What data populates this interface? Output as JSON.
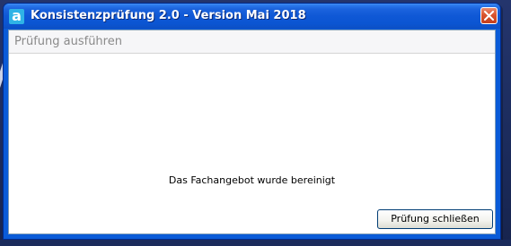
{
  "window": {
    "title": "Konsistenzprüfung 2.0 - Version Mai 2018",
    "app_icon_letter": "a",
    "close_icon": "close-icon"
  },
  "section": {
    "label": "Prüfung ausführen"
  },
  "content": {
    "message": "Das Fachangebot wurde bereinigt"
  },
  "buttons": {
    "close_check_label": "Prüfung schließen"
  },
  "colors": {
    "titlebar": "#0b55d2",
    "close_button": "#d9552f",
    "app_icon": "#2fb3e6"
  }
}
